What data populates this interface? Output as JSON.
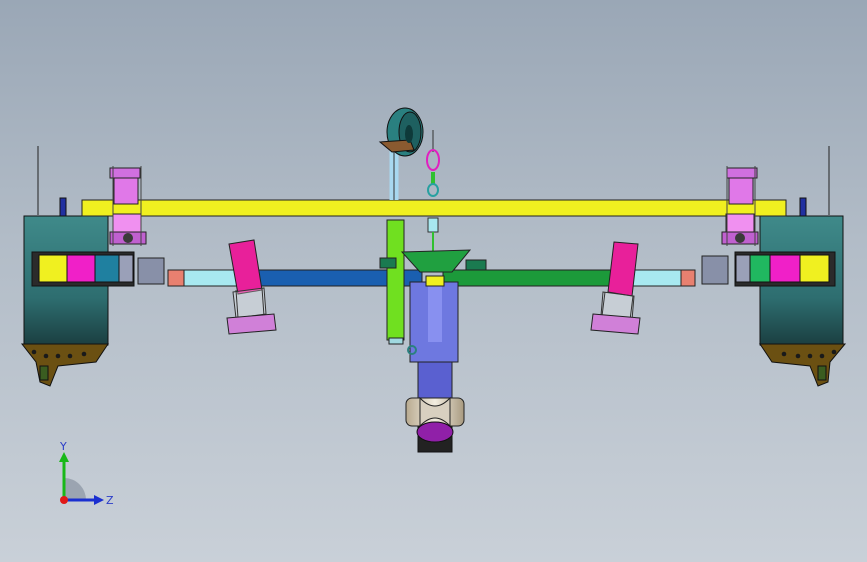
{
  "viewport": {
    "background_top": "#9aa7b6",
    "background_bottom": "#c9d0d8"
  },
  "triad": {
    "y_label": "Y",
    "z_label": "Z",
    "y_color": "#18b818",
    "z_color": "#1a2fd0",
    "x_color": "#e01818"
  },
  "model": {
    "beam_color": "#f0f020",
    "left_arm_color": "#1a5fb0",
    "right_arm_color": "#1c9a3a",
    "arm_end_color": "#a8e8f0",
    "pad_color": "#e8209a",
    "foot_color": "#d080d8",
    "wheel_color": "#2f7878",
    "hub_color": "#b08040",
    "center_post_color": "#6e78e0",
    "cylinder_color": "#70e020",
    "bracket_color": "#d070e0",
    "lower_roller_color": "#9020a8"
  }
}
